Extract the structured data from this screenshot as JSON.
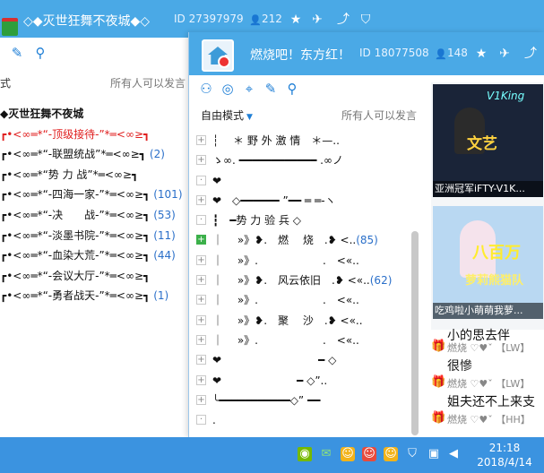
{
  "back_window": {
    "title": "◇◆灭世狂舞不夜城◆◇",
    "room_id": "ID 27397979",
    "member_count": "212",
    "mode_label": "式",
    "permission": "所有人可以发言",
    "channels": [
      {
        "text": "◆灭世狂舞不夜城",
        "count": "",
        "style": "bold"
      },
      {
        "text": "┏•<∞═*“-顶级接待-”*═<∞≥┓",
        "count": "",
        "style": "red"
      },
      {
        "text": "┏•<∞═*“-联盟统战”*═<∞≥┓",
        "count": "(2)",
        "style": ""
      },
      {
        "text": "┏•<∞═*“势 力 战”*═<∞≥┓",
        "count": "",
        "style": ""
      },
      {
        "text": "┏•<∞═*“-四海一家-”*═<∞≥┓",
        "count": "(101)",
        "style": ""
      },
      {
        "text": "┏•<∞═*“-决　　战-”*═<∞≥┓",
        "count": "(53)",
        "style": ""
      },
      {
        "text": "┏•<∞═*“-淡墨书院-”*═<∞≥┓",
        "count": "(11)",
        "style": ""
      },
      {
        "text": "┏•<∞═*“-血染大荒-”*═<∞≥┓",
        "count": "(44)",
        "style": ""
      },
      {
        "text": "┏•<∞═*“-会议大厅-”*═<∞≥┓",
        "count": "",
        "style": ""
      },
      {
        "text": "┏•<∞═*“-勇者战天-”*═<∞≥┓",
        "count": "(1)",
        "style": ""
      }
    ]
  },
  "front_window": {
    "title": "燃烧吧！东方红！",
    "room_id": "ID 18077508",
    "member_count": "148",
    "mode_label": "自由模式",
    "permission": "所有人可以发言",
    "channels": [
      {
        "exp": "+",
        "text": "┆　 ＊ 野 外 激 情　＊—..",
        "count": ""
      },
      {
        "exp": "+",
        "text": "ゝ∞. ━━━━━━━━━━━━ .∞ノ",
        "count": ""
      },
      {
        "exp": "·",
        "text": "❤",
        "count": ""
      },
      {
        "exp": "+",
        "text": "❤　◇━━━━━━ ”━━ ═ ═-ヽ",
        "count": ""
      },
      {
        "exp": "·",
        "text": "┇　━势 力 验 兵 ◇",
        "count": ""
      },
      {
        "exp": "+",
        "text": "｜　 »》❥.　燃　 烧　.❥ <..",
        "count": "(85)"
      },
      {
        "exp": "+",
        "text": "｜　 »》.　　　　　　.　<«..",
        "count": ""
      },
      {
        "exp": "+",
        "text": "｜　 »》❥.　风云依旧　.❥ <«..",
        "count": "(62)"
      },
      {
        "exp": "+",
        "text": "｜　 »》.　　　　　　.　<«..",
        "count": ""
      },
      {
        "exp": "+",
        "text": "｜　 »》❥.　聚　 沙　.❥ <«..",
        "count": ""
      },
      {
        "exp": "+",
        "text": "｜　 »》.　　　　　　.　<«..",
        "count": ""
      },
      {
        "exp": "+",
        "text": "❤　　　　　　　　　━ ◇",
        "count": ""
      },
      {
        "exp": "+",
        "text": "❤　　　　　　　━ ◇”..",
        "count": ""
      },
      {
        "exp": "+",
        "text": "╰━━━━━━━━━━━◇” ━━",
        "count": ""
      },
      {
        "exp": "·",
        "text": ".",
        "count": ""
      }
    ],
    "videos": [
      {
        "caption": "亚洲冠军iFTY-V1K...",
        "brand": "V1King",
        "headline": "文艺"
      },
      {
        "caption": "吃鸡啦小萌萌我萝...",
        "brand": "",
        "headline": "八百万",
        "sub": "萝莉熊猫队"
      }
    ],
    "chat": [
      {
        "msg": "小的思去伴",
        "meta": ""
      },
      {
        "msg": "很慘",
        "meta": "燃烧 ♡♥ˇ 【LW】"
      },
      {
        "msg": "姐夫还不上来支",
        "meta": "燃烧 ♡♥ˇ 【LW】"
      },
      {
        "msg": "",
        "meta": "燃烧 ♡♥ˇ 【HH】"
      }
    ]
  },
  "taskbar": {
    "time": "21:18",
    "date": "2018/4/14"
  }
}
